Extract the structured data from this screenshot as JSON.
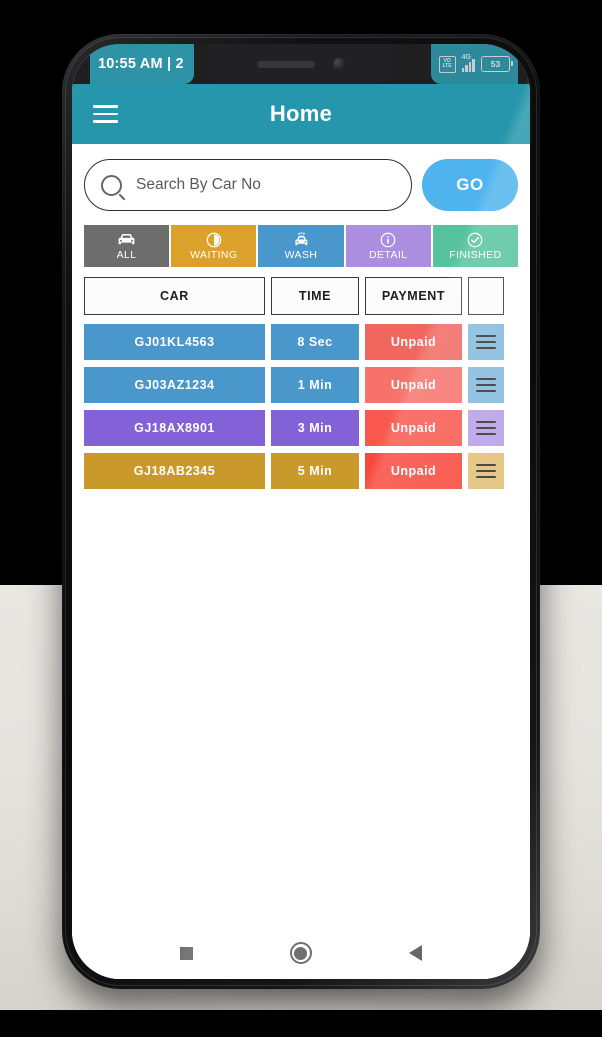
{
  "status_bar": {
    "time": "10:55 AM | 2",
    "volte_top": "VO",
    "volte_bottom": "LTE",
    "network": "4G",
    "battery_level": "53"
  },
  "app_bar": {
    "title": "Home",
    "menu_icon": "hamburger-menu-icon"
  },
  "search": {
    "placeholder": "Search By Car No",
    "value": "",
    "icon": "search-icon",
    "go_label": "GO",
    "go_color": "#4fb4ee"
  },
  "filter_tabs": [
    {
      "label": "ALL",
      "icon": "car-icon",
      "color": "#6d6d6d"
    },
    {
      "label": "WAITING",
      "icon": "clock-moon-icon",
      "color": "#dca12b"
    },
    {
      "label": "WASH",
      "icon": "car-wash-icon",
      "color": "#4a97cb"
    },
    {
      "label": "DETAIL",
      "icon": "info-circle-icon",
      "color": "#ab8ee0"
    },
    {
      "label": "FINISHED",
      "icon": "check-circle-icon",
      "color": "#57c39e"
    }
  ],
  "table": {
    "headers": [
      "CAR",
      "TIME",
      "PAYMENT",
      ""
    ],
    "rows": [
      {
        "car": "GJ01KL4563",
        "time": "8 Sec",
        "payment": "Unpaid",
        "row_color": "#4a97cb",
        "payment_color": "#f1675f",
        "action_color": "#84bade",
        "action_icon": "row-menu-icon"
      },
      {
        "car": "GJ03AZ1234",
        "time": "1 Min",
        "payment": "Unpaid",
        "row_color": "#4a97cb",
        "payment_color": "#f6726a",
        "action_color": "#84bade",
        "action_icon": "row-menu-icon"
      },
      {
        "car": "GJ18AX8901",
        "time": "3 Min",
        "payment": "Unpaid",
        "row_color": "#8362d8",
        "payment_color": "#f8584e",
        "action_color": "#b8a0e8",
        "action_icon": "row-menu-icon"
      },
      {
        "car": "GJ18AB2345",
        "time": "5 Min",
        "payment": "Unpaid",
        "row_color": "#c99a2b",
        "payment_color": "#f8483d",
        "action_color": "#e2c179",
        "action_icon": "row-menu-icon"
      }
    ]
  },
  "nav_bar": {
    "recents": "square-recents-icon",
    "home": "circle-home-icon",
    "back": "triangle-back-icon"
  }
}
